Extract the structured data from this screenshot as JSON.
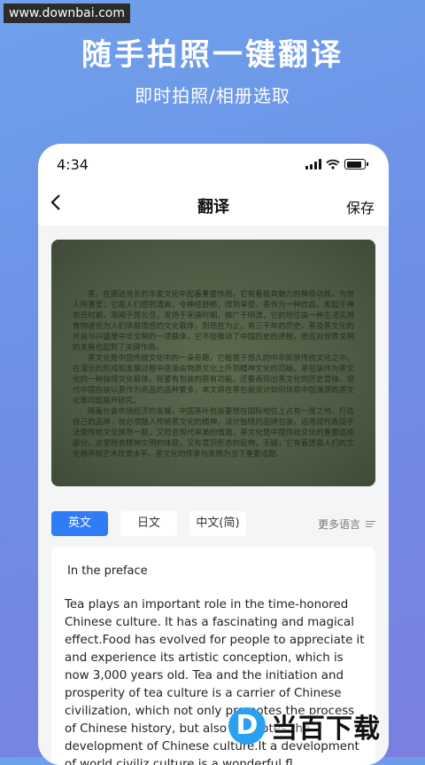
{
  "watermark_site": "www.downbai.com",
  "hero": {
    "title": "随手拍照一键翻译",
    "subtitle": "即时拍照/相册选取"
  },
  "status": {
    "time": "4:34"
  },
  "nav": {
    "back_icon": "chevron-left-icon",
    "title": "翻译",
    "save_label": "保存"
  },
  "photo": {
    "paragraphs": [
      "茶，在源远流长的华夏文化中起着重要作用，它有着极具魅力的神奇功效，为世人所喜爱；它能人们感到清爽，令神经舒畅，得到享受。茶作为一种饮品，发起于神农氏时期，渐闻于周公旦，发扬于宋唐时期，推广于明清，它的地位由一种生活实用食物进化为人们承载情感的文化载体，到现在为止，有三千年的历史。茶及茶文化的开启与兴盛是中华文明的一项载体，它不但推动了中国历史的进程，而且对世界文明的发展也起到了关键作用。",
      "茶文化是中国传统文化中的一朵奇葩，它植根于悠久的中华民族传统文化之中，在漫长的形成和发展过程中逐渐由物质文化上升到精神文化的范畴。茶包装作为茶文化的一种独特文化载体，既要有包装的原有功能，还要表现出茶文化的历史意味。现代中国包装以茶作为商品的品种繁多，本文将在茶包装设计如何体现中国渊源的茶文化等问题展开研究。",
      "随着社会市场经济的发展，中国茶叶包装要想在国际地位上占有一席之地，打造自己的品牌，就必须融入传统茶文化的精神，设计独特的品牌包装，运用现代表现手法使传统文化焕然一新，又符合现代审美的情趣，茶文化是中国传统文化的重要组成部分，这里既有精神文明的体现，又有意识形态的延伸，无疑，它有着提高人们的文化修养和艺术欣赏水平。茶文化的传承与发扬为当下重要话题。"
    ]
  },
  "languages": {
    "tabs": [
      "英文",
      "日文",
      "中文(简)"
    ],
    "active_index": 0,
    "more_label": "更多语言",
    "more_icon": "menu-lines-icon"
  },
  "translation": {
    "heading": "In the preface",
    "body": "Tea plays an important role in the time-honored Chinese culture. It has a fascinating and magical effect.Food has evolved for people to appreciate it and experience its artistic conception, which is now 3,000 years old. Tea and the initiation and prosperity of tea culture is a carrier of Chinese civilization, which not only promotes the process of Chinese history, but also promotes the development of Chinese culture.It a development of world civiliz culture is a wonderful fl"
  },
  "logo": {
    "letter": "D",
    "text": "当百下载"
  },
  "colors": {
    "accent": "#2f7cf6",
    "logo_blue": "#2aa0f0"
  }
}
